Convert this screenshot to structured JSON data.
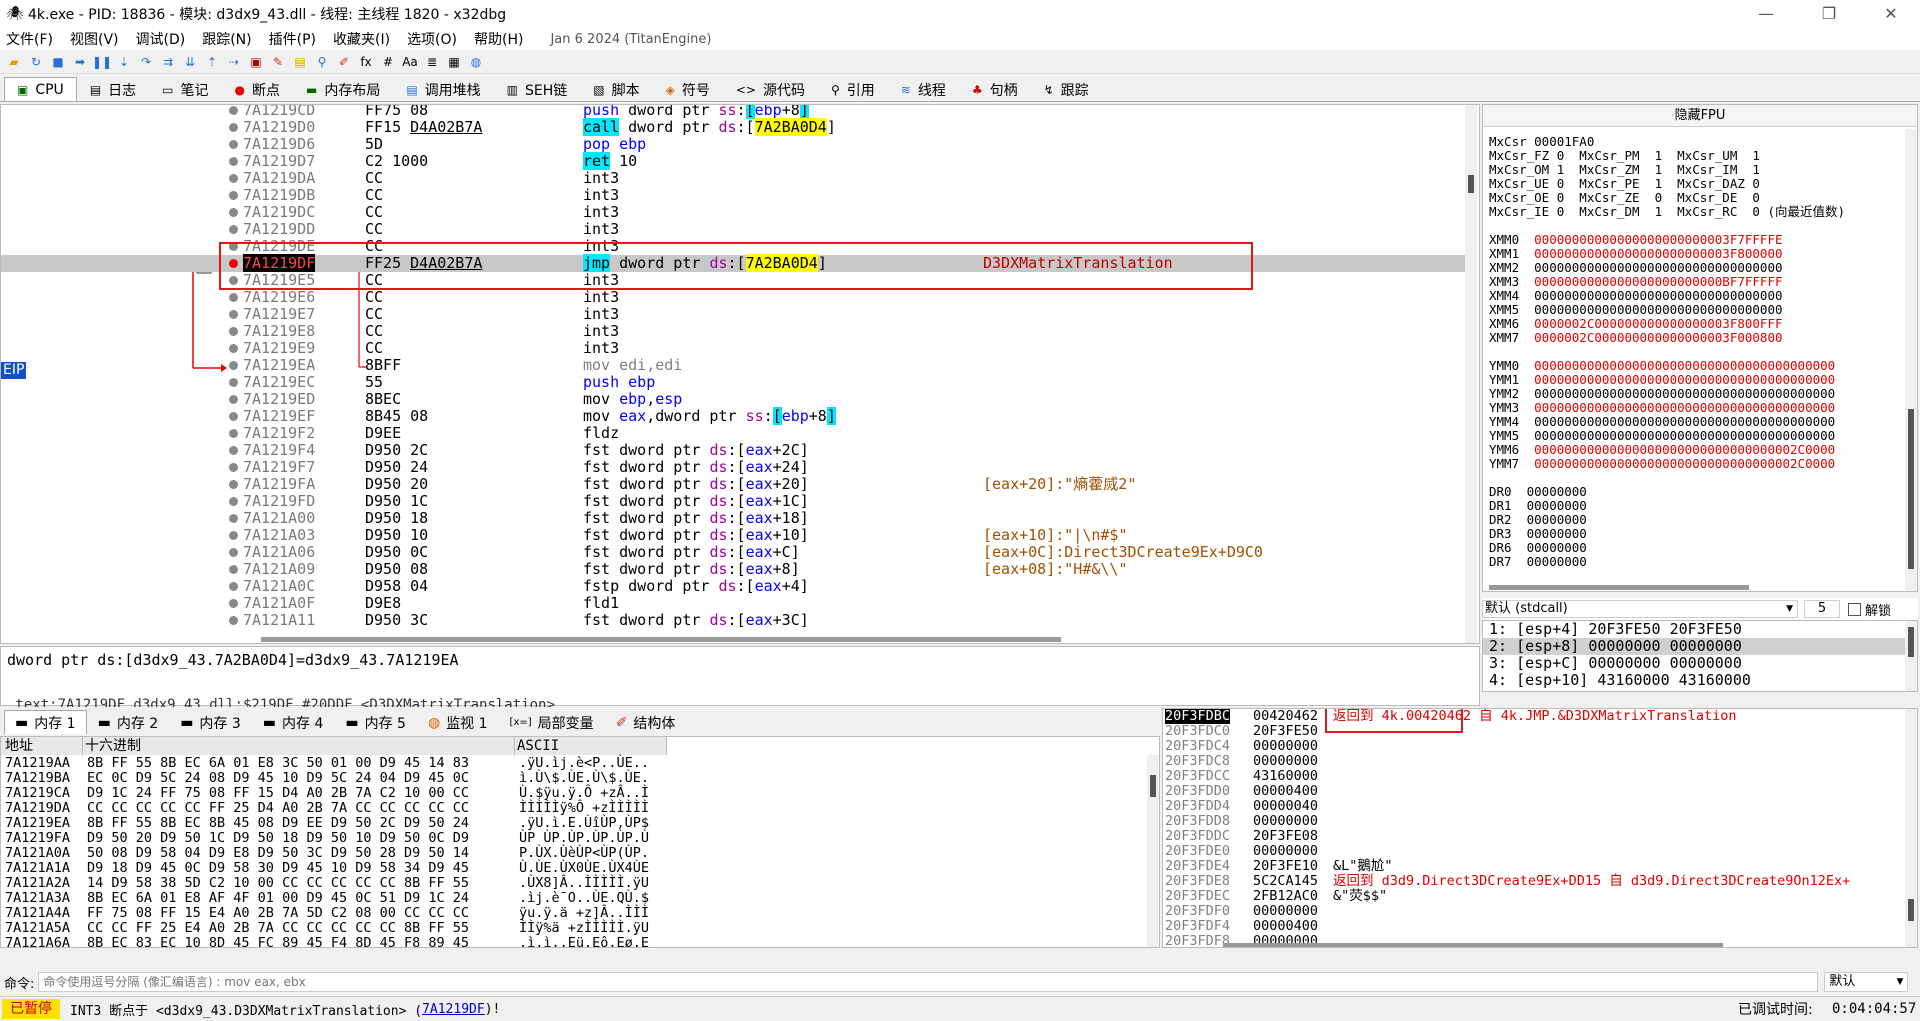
{
  "title": "4k.exe - PID: 18836 - 模块: d3dx9_43.dll - 线程: 主线程 1820 - x32dbg",
  "menu": [
    "文件(F)",
    "视图(V)",
    "调试(D)",
    "跟踪(N)",
    "插件(P)",
    "收藏夹(I)",
    "选项(O)",
    "帮助(H)"
  ],
  "build_date": "Jan 6 2024 (TitanEngine)",
  "tabs": [
    "CPU",
    "日志",
    "笔记",
    "断点",
    "内存布局",
    "调用堆栈",
    "SEH链",
    "脚本",
    "符号",
    "源代码",
    "引用",
    "线程",
    "句柄",
    "跟踪"
  ],
  "eip_label": "EIP",
  "disasm": [
    {
      "addr": "7A1219CD",
      "bytes": "FF75 08",
      "instr": "push dword ptr ss:[ebp+8]",
      "cmt": ""
    },
    {
      "addr": "7A1219D0",
      "bytes": "FF15 D4A02B7A",
      "instr": "call dword ptr ds:[7A2BA0D4]",
      "cmt": ""
    },
    {
      "addr": "7A1219D6",
      "bytes": "5D",
      "instr": "pop ebp",
      "cmt": ""
    },
    {
      "addr": "7A1219D7",
      "bytes": "C2 1000",
      "instr": "ret 10",
      "cmt": ""
    },
    {
      "addr": "7A1219DA",
      "bytes": "CC",
      "instr": "int3",
      "cmt": ""
    },
    {
      "addr": "7A1219DB",
      "bytes": "CC",
      "instr": "int3",
      "cmt": ""
    },
    {
      "addr": "7A1219DC",
      "bytes": "CC",
      "instr": "int3",
      "cmt": ""
    },
    {
      "addr": "7A1219DD",
      "bytes": "CC",
      "instr": "int3",
      "cmt": ""
    },
    {
      "addr": "7A1219DE",
      "bytes": "CC",
      "instr": "int3",
      "cmt": ""
    },
    {
      "addr": "7A1219DF",
      "bytes": "FF25 D4A02B7A",
      "instr": "jmp dword ptr ds:[7A2BA0D4]",
      "cmt": "D3DXMatrixTranslation"
    },
    {
      "addr": "7A1219E5",
      "bytes": "CC",
      "instr": "int3",
      "cmt": ""
    },
    {
      "addr": "7A1219E6",
      "bytes": "CC",
      "instr": "int3",
      "cmt": ""
    },
    {
      "addr": "7A1219E7",
      "bytes": "CC",
      "instr": "int3",
      "cmt": ""
    },
    {
      "addr": "7A1219E8",
      "bytes": "CC",
      "instr": "int3",
      "cmt": ""
    },
    {
      "addr": "7A1219E9",
      "bytes": "CC",
      "instr": "int3",
      "cmt": ""
    },
    {
      "addr": "7A1219EA",
      "bytes": "8BFF",
      "instr": "mov edi,edi",
      "cmt": ""
    },
    {
      "addr": "7A1219EC",
      "bytes": "55",
      "instr": "push ebp",
      "cmt": ""
    },
    {
      "addr": "7A1219ED",
      "bytes": "8BEC",
      "instr": "mov ebp,esp",
      "cmt": ""
    },
    {
      "addr": "7A1219EF",
      "bytes": "8B45 08",
      "instr": "mov eax,dword ptr ss:[ebp+8]",
      "cmt": ""
    },
    {
      "addr": "7A1219F2",
      "bytes": "D9EE",
      "instr": "fldz",
      "cmt": ""
    },
    {
      "addr": "7A1219F4",
      "bytes": "D950 2C",
      "instr": "fst dword ptr ds:[eax+2C]",
      "cmt": ""
    },
    {
      "addr": "7A1219F7",
      "bytes": "D950 24",
      "instr": "fst dword ptr ds:[eax+24]",
      "cmt": ""
    },
    {
      "addr": "7A1219FA",
      "bytes": "D950 20",
      "instr": "fst dword ptr ds:[eax+20]",
      "cmt": "[eax+20]:\"熵藿烕2\""
    },
    {
      "addr": "7A1219FD",
      "bytes": "D950 1C",
      "instr": "fst dword ptr ds:[eax+1C]",
      "cmt": ""
    },
    {
      "addr": "7A121A00",
      "bytes": "D950 18",
      "instr": "fst dword ptr ds:[eax+18]",
      "cmt": ""
    },
    {
      "addr": "7A121A03",
      "bytes": "D950 10",
      "instr": "fst dword ptr ds:[eax+10]",
      "cmt": "[eax+10]:\"|\\n#$\""
    },
    {
      "addr": "7A121A06",
      "bytes": "D950 0C",
      "instr": "fst dword ptr ds:[eax+C]",
      "cmt": "[eax+0C]:Direct3DCreate9Ex+D9C0"
    },
    {
      "addr": "7A121A09",
      "bytes": "D950 08",
      "instr": "fst dword ptr ds:[eax+8]",
      "cmt": "[eax+08]:\"H#&\\\\\""
    },
    {
      "addr": "7A121A0C",
      "bytes": "D958 04",
      "instr": "fstp dword ptr ds:[eax+4]",
      "cmt": ""
    },
    {
      "addr": "7A121A0F",
      "bytes": "D9E8",
      "instr": "fld1",
      "cmt": ""
    },
    {
      "addr": "7A121A11",
      "bytes": "D950 3C",
      "instr": "fst dword ptr ds:[eax+3C]",
      "cmt": ""
    }
  ],
  "info_line": "dword ptr ds:[d3dx9_43.7A2BA0D4]=d3dx9_43.7A1219EA",
  "info_line2": ".text:7A1219DF d3dx9_43.dll:$219DF #20DDF <D3DXMatrixTranslation>",
  "regs_header": "隐藏FPU",
  "mxcsr": "MxCsr 00001FA0",
  "mxcsr_flags": [
    "MxCsr_FZ 0  MxCsr_PM  1  MxCsr_UM  1",
    "MxCsr_OM 1  MxCsr_ZM  1  MxCsr_IM  1",
    "MxCsr_UE 0  MxCsr_PE  1  MxCsr_DAZ 0",
    "MxCsr_OE 0  MxCsr_ZE  0  MxCsr_DE  0",
    "MxCsr_IE 0  MxCsr_DM  1  MxCsr_RC  0 (向最近值数)"
  ],
  "xmm": [
    {
      "n": "XMM0",
      "v": "00000000000000000000000003F7FFFFE",
      "red": true
    },
    {
      "n": "XMM1",
      "v": "00000000000000000000000003F800000",
      "red": true
    },
    {
      "n": "XMM2",
      "v": "000000000000000000000000000000000",
      "red": false
    },
    {
      "n": "XMM3",
      "v": "0000000000000000000000000BF7FFFFF",
      "red": true
    },
    {
      "n": "XMM4",
      "v": "000000000000000000000000000000000",
      "red": false
    },
    {
      "n": "XMM5",
      "v": "000000000000000000000000000000000",
      "red": false
    },
    {
      "n": "XMM6",
      "v": "0000002C000000000000000003F800FFF",
      "red": true
    },
    {
      "n": "XMM7",
      "v": "0000002C000000000000000003F000800",
      "red": true
    }
  ],
  "ymm": [
    {
      "n": "YMM0",
      "v": "0000000000000000000000000000000000000000",
      "red": true
    },
    {
      "n": "YMM1",
      "v": "0000000000000000000000000000000000000000",
      "red": true
    },
    {
      "n": "YMM2",
      "v": "0000000000000000000000000000000000000000",
      "red": false
    },
    {
      "n": "YMM3",
      "v": "0000000000000000000000000000000000000000",
      "red": true
    },
    {
      "n": "YMM4",
      "v": "0000000000000000000000000000000000000000",
      "red": false
    },
    {
      "n": "YMM5",
      "v": "0000000000000000000000000000000000000000",
      "red": false
    },
    {
      "n": "YMM6",
      "v": "00000000000000000000000000000000002C0000",
      "red": true
    },
    {
      "n": "YMM7",
      "v": "00000000000000000000000000000000002C0000",
      "red": true
    }
  ],
  "dr": [
    "DR0  00000000",
    "DR1  00000000",
    "DR2  00000000",
    "DR3  00000000",
    "DR6  00000000",
    "DR7  00000000"
  ],
  "callconv": "默认 (stdcall)",
  "argcount": "5",
  "unlock_label": "解锁",
  "args": [
    "1: [esp+4] 20F3FE50 20F3FE50",
    "2: [esp+8] 00000000 00000000",
    "3: [esp+C] 00000000 00000000",
    "4: [esp+10] 43160000 43160000"
  ],
  "btabs": [
    "内存 1",
    "内存 2",
    "内存 3",
    "内存 4",
    "内存 5",
    "监视 1",
    "局部变量",
    "结构体"
  ],
  "dump_headers": {
    "addr": "地址",
    "hex": "十六进制",
    "ascii": "ASCII"
  },
  "dump": [
    {
      "a": "7A1219AA",
      "h": "8B FF 55 8B EC 6A 01 E8 3C 50 01 00 D9 45 14 83",
      "s": ".ÿU.ìj.è<P..ÙE.."
    },
    {
      "a": "7A1219BA",
      "h": "EC 0C D9 5C 24 08 D9 45 10 D9 5C 24 04 D9 45 0C",
      "s": "ì.Ù\\$.ÙE.Ù\\$.ÙE."
    },
    {
      "a": "7A1219CA",
      "h": "D9 1C 24 FF 75 08 FF 15 D4 A0 2B 7A C2 10 00 CC",
      "s": "Ù.$ÿu.ÿ.Ô +zÂ..Ì"
    },
    {
      "a": "7A1219DA",
      "h": "CC CC CC CC CC FF 25 D4 A0 2B 7A CC CC CC CC CC",
      "s": "ÌÌÌÌÌÿ%Ô +zÌÌÌÌÌ"
    },
    {
      "a": "7A1219EA",
      "h": "8B FF 55 8B EC 8B 45 08 D9 EE D9 50 2C D9 50 24",
      "s": ".ÿU.ì.E.ÙîÙP,ÙP$"
    },
    {
      "a": "7A1219FA",
      "h": "D9 50 20 D9 50 1C D9 50 18 D9 50 10 D9 50 0C D9",
      "s": "ÙP ÙP.ÙP.ÙP.ÙP.Ù"
    },
    {
      "a": "7A121A0A",
      "h": "50 08 D9 58 04 D9 E8 D9 50 3C D9 50 28 D9 50 14",
      "s": "P.ÙX.ÙèÙP<ÙP(ÙP."
    },
    {
      "a": "7A121A1A",
      "h": "D9 18 D9 45 0C D9 58 30 D9 45 10 D9 58 34 D9 45",
      "s": "Ù.ÙE.ÙX0ÙE.ÙX4ÙE"
    },
    {
      "a": "7A121A2A",
      "h": "14 D9 58 38 5D C2 10 00 CC CC CC CC CC 8B FF 55",
      "s": ".ÙX8]Â..ÌÌÌÌÌ.ÿU"
    },
    {
      "a": "7A121A3A",
      "h": "8B EC 6A 01 E8 AF 4F 01 00 D9 45 0C 51 D9 1C 24",
      "s": ".ìj.è¯O..ÙE.QÙ.$"
    },
    {
      "a": "7A121A4A",
      "h": "FF 75 08 FF 15 E4 A0 2B 7A 5D C2 08 00 CC CC CC",
      "s": "ÿu.ÿ.ä +z]Â..ÌÌÌ"
    },
    {
      "a": "7A121A5A",
      "h": "CC CC FF 25 E4 A0 2B 7A CC CC CC CC CC 8B FF 55",
      "s": "ÌÌÿ%ä +zÌÌÌÌÌ.ÿU"
    },
    {
      "a": "7A121A6A",
      "h": "8B EC 83 EC 10 8D 45 FC 89 45 F4 8D 45 F8 89 45",
      "s": ".ì.ì..Eü.Eô.Eø.E"
    }
  ],
  "stack": [
    {
      "a": "20F3FDBC",
      "v": "00420462",
      "c": "返回到 4k.00420462 自 4k.JMP.&D3DXMatrixTranslation"
    },
    {
      "a": "20F3FDC0",
      "v": "20F3FE50",
      "c": ""
    },
    {
      "a": "20F3FDC4",
      "v": "00000000",
      "c": ""
    },
    {
      "a": "20F3FDC8",
      "v": "00000000",
      "c": ""
    },
    {
      "a": "20F3FDCC",
      "v": "43160000",
      "c": ""
    },
    {
      "a": "20F3FDD0",
      "v": "00000400",
      "c": ""
    },
    {
      "a": "20F3FDD4",
      "v": "00000040",
      "c": ""
    },
    {
      "a": "20F3FDD8",
      "v": "00000000",
      "c": ""
    },
    {
      "a": "20F3FDDC",
      "v": "20F3FE08",
      "c": ""
    },
    {
      "a": "20F3FDE0",
      "v": "00000000",
      "c": ""
    },
    {
      "a": "20F3FDE4",
      "v": "20F3FE10",
      "c": "&L\"鵝尬\""
    },
    {
      "a": "20F3FDE8",
      "v": "5C2CA145",
      "c": "返回到 d3d9.Direct3DCreate9Ex+DD15 自 d3d9.Direct3DCreate9On12Ex+"
    },
    {
      "a": "20F3FDEC",
      "v": "2FB12AC0",
      "c": "&\"荧$$\""
    },
    {
      "a": "20F3FDF0",
      "v": "00000000",
      "c": ""
    },
    {
      "a": "20F3FDF4",
      "v": "00000400",
      "c": ""
    },
    {
      "a": "20F3FDF8",
      "v": "00000000",
      "c": ""
    }
  ],
  "cmd_label": "命令:",
  "cmd_placeholder": "命令使用逗号分隔 (像汇编语言) : mov eax, ebx",
  "cmd_mode": "默认",
  "status": {
    "paused": "已暂停",
    "msg": "INT3  断点于 <d3dx9_43.D3DXMatrixTranslation> (",
    "addr": "7A1219DF",
    "msg2": ")!",
    "time_label": "已调试时间:",
    "time": "0:04:04:57"
  }
}
